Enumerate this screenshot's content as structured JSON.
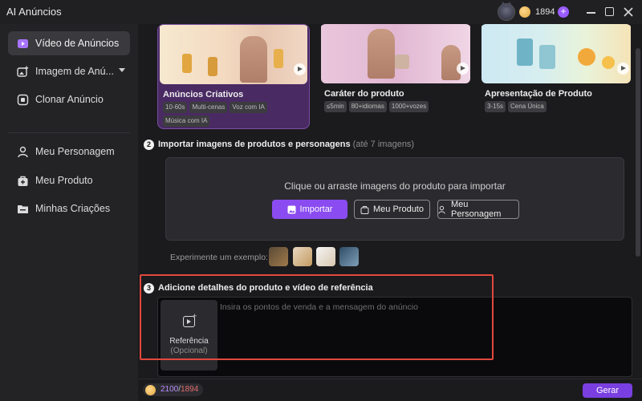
{
  "app": {
    "title": "AI Anúncios",
    "credits": "1894",
    "colors": {
      "accent": "#8a4cf0",
      "highlight": "#e2483d"
    }
  },
  "window_controls": [
    "minimize-icon",
    "maximize-icon",
    "close-icon"
  ],
  "sidebar": {
    "items": [
      {
        "label": "Vídeo de Anúncios",
        "icon": "video-icon",
        "active": true
      },
      {
        "label": "Imagem de Anú...",
        "icon": "image-plus-icon",
        "has_dropdown": true
      },
      {
        "label": "Clonar Anúncio",
        "icon": "clone-icon"
      },
      {
        "label": "Meu Personagem",
        "icon": "person-icon"
      },
      {
        "label": "Meu Produto",
        "icon": "product-bag-icon"
      },
      {
        "label": "Minhas Criações",
        "icon": "folder-icon"
      }
    ]
  },
  "templates": [
    {
      "title": "Anúncios Criativos",
      "tags": [
        "10-60s",
        "Multi-cenas",
        "Voz com IA",
        "Música com IA"
      ],
      "selected": true
    },
    {
      "title": "Caráter do produto",
      "tags": [
        "≤5min",
        "80+idiomas",
        "1000+vozes"
      ]
    },
    {
      "title": "Apresentação de Produto",
      "tags": [
        "3-15s",
        "Cena Única"
      ]
    }
  ],
  "import_section": {
    "step": "2",
    "title": "Importar imagens de produtos e personagens",
    "hint": "(até 7 imagens)",
    "drop_text": "Clique ou arraste imagens do produto para importar",
    "import_button": "Importar",
    "product_button": "Meu Produto",
    "persona_button": "Meu Personagem",
    "example_label": "Experimente um exemplo:"
  },
  "details_section": {
    "step": "3",
    "title": "Adicione detalhes do produto e vídeo de referência",
    "reference_label": "Referência",
    "reference_sub": "(Opcional)",
    "input_placeholder": "Insira os pontos de venda e a mensagem do anúncio",
    "input_value": ""
  },
  "footer": {
    "credits_needed": "2100",
    "separator": "/",
    "credits_available": "1894",
    "generate_button": "Gerar"
  }
}
